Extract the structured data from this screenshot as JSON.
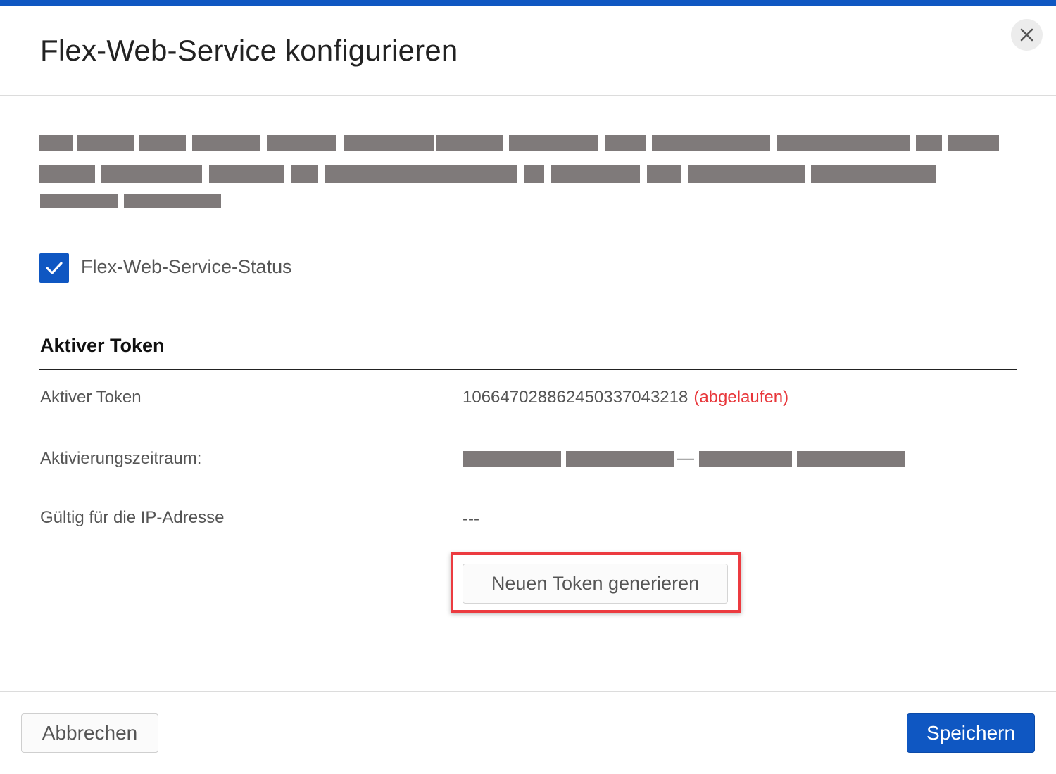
{
  "dialog": {
    "title": "Flex-Web-Service konfigurieren",
    "close_icon": "close-icon"
  },
  "description": {
    "redacted": true
  },
  "status": {
    "checked": true,
    "label": "Flex-Web-Service-Status"
  },
  "token_section": {
    "title": "Aktiver Token",
    "rows": {
      "active_token": {
        "label": "Aktiver Token",
        "value": "106647028862450337043218",
        "status": "(abgelaufen)"
      },
      "activation_period": {
        "label": "Aktivierungszeitraum:",
        "separator": "—",
        "redacted": true
      },
      "valid_ip": {
        "label": "Gültig für die IP-Adresse",
        "value": "---"
      }
    },
    "generate_button": "Neuen Token generieren"
  },
  "footer": {
    "cancel": "Abbrechen",
    "save": "Speichern"
  },
  "colors": {
    "accent": "#0f57c2",
    "expired": "#e8363a",
    "highlight": "#ec3b40",
    "redaction": "#7f7a7a"
  }
}
